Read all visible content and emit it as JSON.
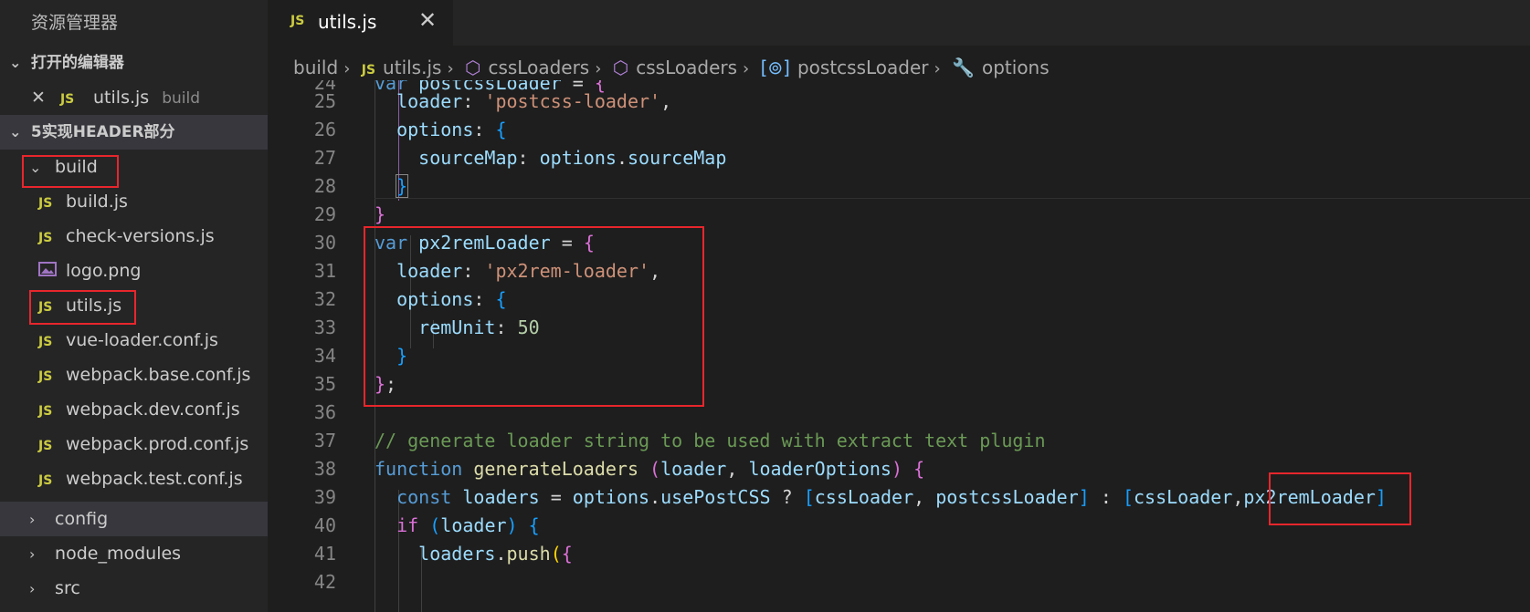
{
  "sidebar": {
    "title": "资源管理器",
    "open_editors": {
      "header": "打开的编辑器",
      "items": [
        {
          "badge": "JS",
          "name": "utils.js",
          "folder": "build"
        }
      ]
    },
    "project": {
      "header": "5实现HEADER部分",
      "folder_build": "build",
      "files": [
        {
          "badge": "JS",
          "name": "build.js"
        },
        {
          "badge": "JS",
          "name": "check-versions.js"
        },
        {
          "badge": "",
          "name": "logo.png"
        },
        {
          "badge": "JS",
          "name": "utils.js"
        },
        {
          "badge": "JS",
          "name": "vue-loader.conf.js"
        },
        {
          "badge": "JS",
          "name": "webpack.base.conf.js"
        },
        {
          "badge": "JS",
          "name": "webpack.dev.conf.js"
        },
        {
          "badge": "JS",
          "name": "webpack.prod.conf.js"
        },
        {
          "badge": "JS",
          "name": "webpack.test.conf.js"
        }
      ],
      "folders": [
        "config",
        "node_modules",
        "src"
      ]
    }
  },
  "tab": {
    "badge": "JS",
    "label": "utils.js"
  },
  "breadcrumb": [
    "build",
    "utils.js",
    "cssLoaders",
    "cssLoaders",
    "postcssLoader",
    "options"
  ],
  "code": {
    "line_numbers": [
      "24",
      "25",
      "26",
      "27",
      "28",
      "29",
      "30",
      "31",
      "32",
      "33",
      "34",
      "35",
      "36",
      "37",
      "38",
      "39",
      "40",
      "41",
      "42"
    ],
    "comment37": "// generate loader string to be used with extract text plugin"
  },
  "colors": {
    "accent_red": "#e8262c",
    "js_badge": "#cbcb41",
    "sidebar_bg": "#252526",
    "editor_bg": "#1e1e1e"
  }
}
